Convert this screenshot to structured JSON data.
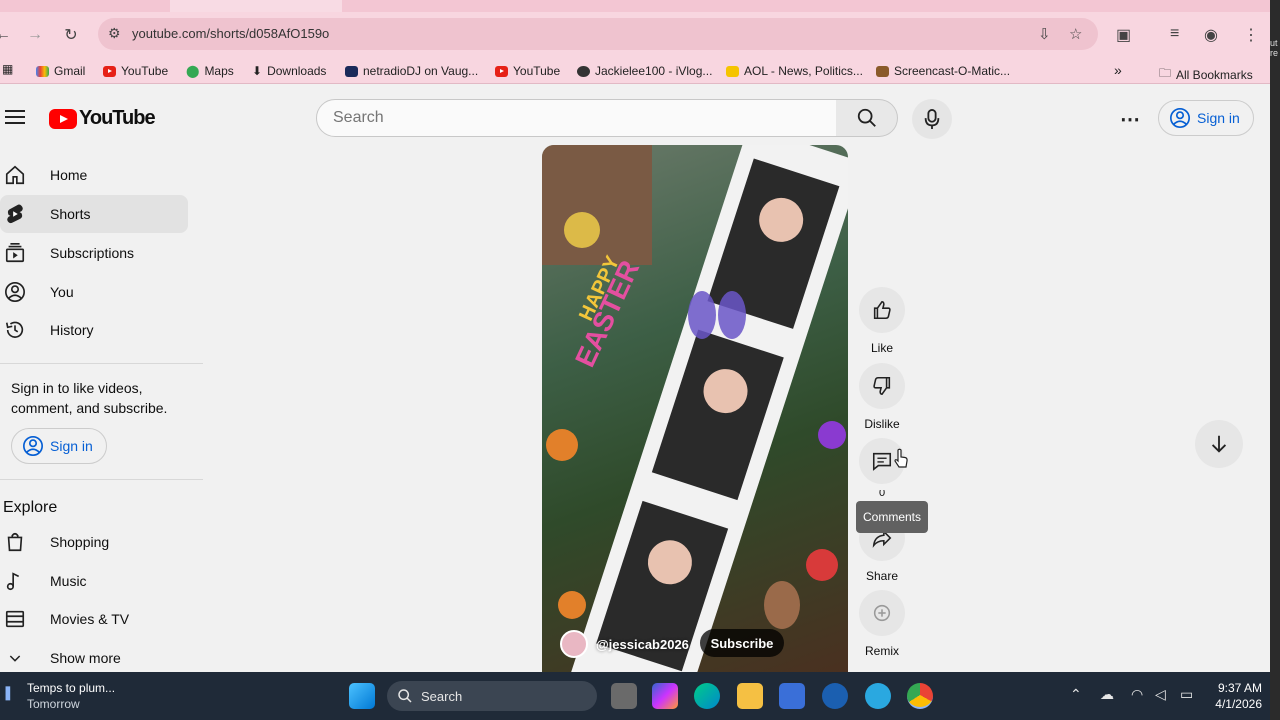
{
  "browser": {
    "url": "youtube.com/shorts/d058AfO159o",
    "bookmarks": [
      {
        "label": "Gmail",
        "icon": "gmail-icon"
      },
      {
        "label": "YouTube",
        "icon": "youtube-icon"
      },
      {
        "label": "Maps",
        "icon": "maps-icon"
      },
      {
        "label": "Downloads",
        "icon": "download-icon"
      },
      {
        "label": "netradioDJ on Vaug...",
        "icon": "netradio-icon"
      },
      {
        "label": "YouTube",
        "icon": "youtube-icon"
      },
      {
        "label": "Jackielee100 - iVlog...",
        "icon": "globe-icon"
      },
      {
        "label": "AOL - News, Politics...",
        "icon": "aol-icon"
      },
      {
        "label": "Screencast-O-Matic...",
        "icon": "screencast-icon"
      }
    ],
    "all_bookmarks": "All Bookmarks",
    "more_bookmarks": "»"
  },
  "header": {
    "logo_text": "YouTube",
    "search_placeholder": "Search",
    "signin_label": "Sign in"
  },
  "sidebar": {
    "items": [
      {
        "label": "Home",
        "icon": "home-icon"
      },
      {
        "label": "Shorts",
        "icon": "shorts-icon",
        "active": true
      },
      {
        "label": "Subscriptions",
        "icon": "subscriptions-icon"
      },
      {
        "label": "You",
        "icon": "user-icon"
      },
      {
        "label": "History",
        "icon": "history-icon"
      }
    ],
    "signin_message": "Sign in to like videos, comment, and subscribe.",
    "signin_label": "Sign in",
    "explore_heading": "Explore",
    "explore_items": [
      {
        "label": "Shopping",
        "icon": "shopping-icon"
      },
      {
        "label": "Music",
        "icon": "music-icon"
      },
      {
        "label": "Movies & TV",
        "icon": "movies-icon"
      },
      {
        "label": "Show more",
        "icon": "chevron-down-icon"
      }
    ]
  },
  "video": {
    "channel_handle": "@jessicab2026",
    "subscribe_label": "Subscribe"
  },
  "actions": {
    "like": "Like",
    "dislike": "Dislike",
    "comments_count": "0",
    "comments_tooltip": "Comments",
    "share": "Share",
    "remix": "Remix"
  },
  "taskbar": {
    "weather_title": "Temps to plum...",
    "weather_sub": "Tomorrow",
    "search_label": "Search",
    "time": "9:37 AM",
    "date": "4/1/2026"
  }
}
